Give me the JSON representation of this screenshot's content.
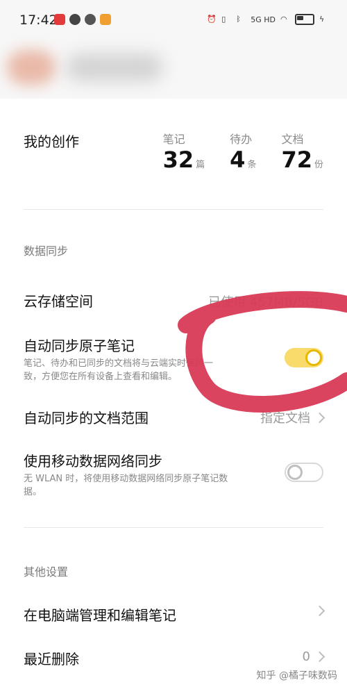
{
  "status_bar": {
    "time": "17:42",
    "network": "5G HD",
    "icons": [
      "alarm-icon",
      "vibrate-icon",
      "bluetooth-icon",
      "signal-icon",
      "wifi-icon",
      "battery-icon",
      "charging-icon"
    ]
  },
  "creations": {
    "title": "我的创作",
    "stats": [
      {
        "label": "笔记",
        "value": "32",
        "unit": "篇"
      },
      {
        "label": "待办",
        "value": "4",
        "unit": "条"
      },
      {
        "label": "文档",
        "value": "72",
        "unit": "份"
      }
    ]
  },
  "sync": {
    "section_title": "数据同步",
    "cloud_storage": {
      "label": "云存储空间",
      "value": "已使用 457MB/5GB"
    },
    "auto_sync": {
      "label": "自动同步原子笔记",
      "desc_line1": "笔记、待办和已同步的文档将与云端实时保持一",
      "desc_line2": "致，方便您在所有设备上查看和编辑。",
      "enabled": true
    },
    "doc_scope": {
      "label": "自动同步的文档范围",
      "value": "指定文档"
    },
    "mobile_data": {
      "label": "使用移动数据网络同步",
      "desc_line1": "无 WLAN 时，将使用移动数据网络同步原子笔记数",
      "desc_line2": "据。",
      "enabled": false
    }
  },
  "other": {
    "section_title": "其他设置",
    "pc_manage": {
      "label": "在电脑端管理和编辑笔记"
    },
    "recently_deleted": {
      "label": "最近删除",
      "count": "0"
    }
  },
  "watermark": "知乎 @橘子味数码",
  "colors": {
    "toggle_on": "#f8db6a",
    "toggle_knob_ring": "#e7b800",
    "annotation": "#d93a55"
  }
}
